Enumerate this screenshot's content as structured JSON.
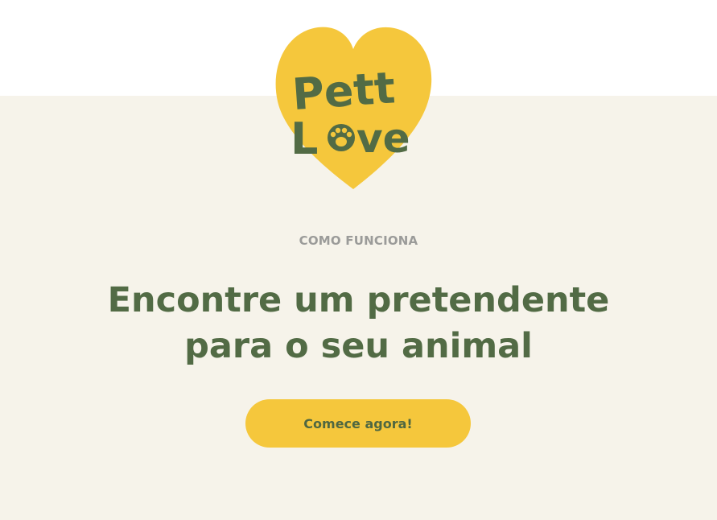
{
  "logo": {
    "line1": "Pett",
    "line2_prefix": "L",
    "line2_suffix": "ve",
    "heart_color": "#f5c73c",
    "text_color": "#526b45",
    "icon": "paw-icon"
  },
  "hero": {
    "eyebrow": "COMO FUNCIONA",
    "headline_line1": "Encontre um pretendente",
    "headline_line2": "para o seu animal",
    "cta_label": "Comece agora!"
  },
  "colors": {
    "background": "#f6f3ea",
    "accent": "#f5c73c",
    "primary_text": "#526b45",
    "muted_text": "#9b9b99"
  }
}
